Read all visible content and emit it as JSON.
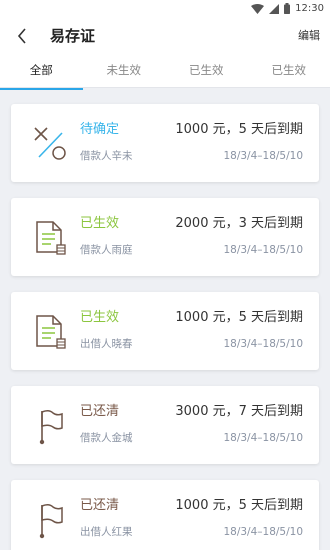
{
  "status_bar": {
    "time": "12:30"
  },
  "header": {
    "title": "易存证",
    "edit_label": "编辑"
  },
  "tabs": [
    {
      "label": "全部",
      "active": true
    },
    {
      "label": "未生效",
      "active": false
    },
    {
      "label": "已生效",
      "active": false
    },
    {
      "label": "已生效",
      "active": false
    }
  ],
  "colors": {
    "accent": "#2aa6e8",
    "pending": "#39b5ea",
    "effective": "#8cc63f",
    "settled": "#7a5a4a"
  },
  "cards": [
    {
      "status": "待确定",
      "status_color": "#39b5ea",
      "icon": "pending-icon",
      "person": "借款人辛未",
      "amount": "1000 元，5 天后到期",
      "dates": "18/3/4–18/5/10"
    },
    {
      "status": "已生效",
      "status_color": "#8cc63f",
      "icon": "document-icon",
      "person": "借款人雨庭",
      "amount": "2000 元，3 天后到期",
      "dates": "18/3/4–18/5/10"
    },
    {
      "status": "已生效",
      "status_color": "#8cc63f",
      "icon": "document-icon",
      "person": "出借人晓春",
      "amount": "1000 元，5 天后到期",
      "dates": "18/3/4–18/5/10"
    },
    {
      "status": "已还清",
      "status_color": "#7a5a4a",
      "icon": "flag-icon",
      "person": "借款人金城",
      "amount": "3000 元，7 天后到期",
      "dates": "18/3/4–18/5/10"
    },
    {
      "status": "已还清",
      "status_color": "#7a5a4a",
      "icon": "flag-icon",
      "person": "出借人红果",
      "amount": "1000 元，5 天后到期",
      "dates": "18/3/4–18/5/10"
    }
  ]
}
